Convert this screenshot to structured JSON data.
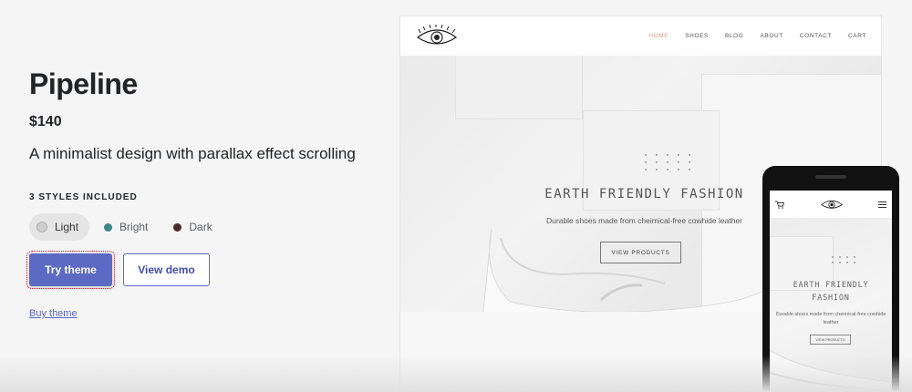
{
  "theme": {
    "title": "Pipeline",
    "price": "$140",
    "description": "A minimalist design with parallax effect scrolling",
    "styles_heading": "3 STYLES INCLUDED",
    "styles": [
      {
        "label": "Light",
        "color": "#cfcfcf",
        "selected": true
      },
      {
        "label": "Bright",
        "color": "#3b8686",
        "selected": false
      },
      {
        "label": "Dark",
        "color": "#4a2b2b",
        "selected": false
      }
    ],
    "try_label": "Try theme",
    "demo_label": "View demo",
    "buy_label": "Buy theme"
  },
  "colors": {
    "accent": "#5c6ac4",
    "nav_active": "#e49a85"
  },
  "preview": {
    "nav": [
      "HOME",
      "SHOES",
      "BLOG",
      "ABOUT",
      "CONTACT",
      "CART"
    ],
    "hero_title": "EARTH FRIENDLY FASHION",
    "hero_subtitle": "Durable shoes made from cheimical-free cowhide leather",
    "hero_button": "VIEW PRODUCTS",
    "mobile_title_line1": "EARTH FRIENDLY",
    "mobile_title_line2": "FASHION",
    "mobile_subtitle": "Durable shoes made from cheimical-free cowhide leather",
    "mobile_button": "VIEW PRODUCTS"
  }
}
